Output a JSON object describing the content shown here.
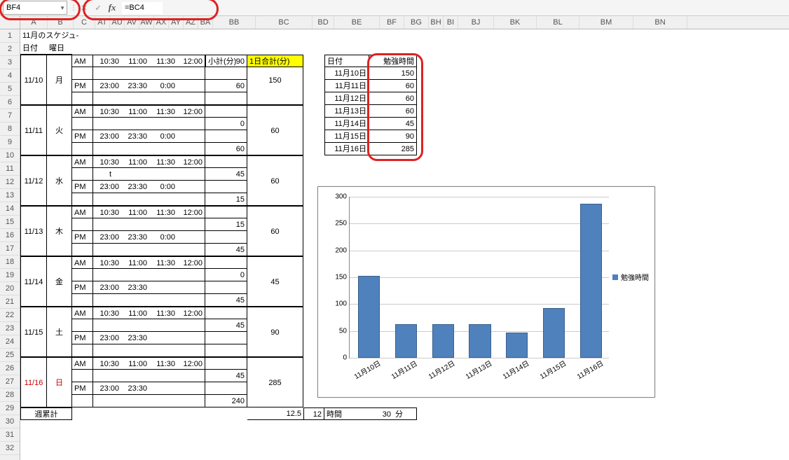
{
  "formula_bar": {
    "cell_ref": "BF4",
    "formula": "=BC4",
    "fx_label": "fx",
    "cancel": "✕",
    "confirm": "✓"
  },
  "columns": [
    "A",
    "B",
    "C",
    "AT",
    "AU",
    "AV",
    "AW",
    "AX",
    "AY",
    "AZ",
    "BA",
    "BB",
    "BC",
    "BD",
    "BE",
    "BF",
    "BG",
    "BH",
    "BI",
    "BJ",
    "BK",
    "BL",
    "BM",
    "BN"
  ],
  "col_widths": {
    "A": 38,
    "B": 36,
    "C": 30,
    "AT": 20,
    "AU": 20,
    "AV": 20,
    "AW": 20,
    "AX": 20,
    "AY": 20,
    "AZ": 20,
    "BA": 20,
    "BB": 60,
    "BC": 80,
    "BD": 30,
    "BE": 64,
    "BF": 34,
    "BG": 34,
    "BH": 20,
    "BI": 20,
    "BJ": 50,
    "BK": 60,
    "BL": 60,
    "BM": 76,
    "BN": 76
  },
  "row_count": 32,
  "title": "11月のスケジュ-",
  "headers": {
    "date": "日付",
    "weekday": "曜日",
    "subtotal": "小計(分)",
    "day_total": "1日合計(分)",
    "study_time": "勉強時間",
    "week_total": "週累計",
    "hours": "時間",
    "minutes": "分",
    "am": "AM",
    "pm": "PM"
  },
  "schedule": [
    {
      "date": "11/10",
      "wd": "月",
      "am": [
        "10:30",
        "11:00",
        "11:30",
        "12:00"
      ],
      "pm": [
        "23:00",
        "23:30",
        "0:00",
        ""
      ],
      "sub": [
        90,
        "",
        60,
        ""
      ],
      "total": 150
    },
    {
      "date": "11/11",
      "wd": "火",
      "am": [
        "10:30",
        "11:00",
        "11:30",
        "12:00"
      ],
      "pm": [
        "23:00",
        "23:30",
        "0:00",
        ""
      ],
      "sub": [
        "",
        0,
        "",
        60
      ],
      "total": 60
    },
    {
      "date": "11/12",
      "wd": "水",
      "am": [
        "10:30",
        "11:00",
        "11:30",
        "12:00"
      ],
      "pm": [
        "23:00",
        "23:30",
        "0:00",
        ""
      ],
      "sub": [
        "",
        45,
        "",
        15
      ],
      "total": 60,
      "extra_t": true
    },
    {
      "date": "11/13",
      "wd": "木",
      "am": [
        "10:30",
        "11:00",
        "11:30",
        "12:00"
      ],
      "pm": [
        "23:00",
        "23:30",
        "0:00",
        ""
      ],
      "sub": [
        "",
        15,
        "",
        45
      ],
      "total": 60
    },
    {
      "date": "11/14",
      "wd": "金",
      "am": [
        "10:30",
        "11:00",
        "11:30",
        "12:00"
      ],
      "pm": [
        "23:00",
        "23:30",
        "",
        ""
      ],
      "sub": [
        "",
        0,
        "",
        45
      ],
      "total": 45
    },
    {
      "date": "11/15",
      "wd": "土",
      "am": [
        "10:30",
        "11:00",
        "11:30",
        "12:00"
      ],
      "pm": [
        "23:00",
        "23:30",
        "",
        ""
      ],
      "sub": [
        "",
        45,
        "",
        ""
      ],
      "total": 90
    },
    {
      "date": "11/16",
      "wd": "日",
      "am": [
        "10:30",
        "11:00",
        "11:30",
        "12:00"
      ],
      "pm": [
        "23:00",
        "23:30",
        "",
        ""
      ],
      "sub": [
        "",
        45,
        "",
        240
      ],
      "total": 285,
      "red": true
    }
  ],
  "summary_table": [
    {
      "date": "11月10日",
      "val": 150
    },
    {
      "date": "11月11日",
      "val": 60
    },
    {
      "date": "11月12日",
      "val": 60
    },
    {
      "date": "11月13日",
      "val": 60
    },
    {
      "date": "11月14日",
      "val": 45
    },
    {
      "date": "11月15日",
      "val": 90
    },
    {
      "date": "11月16日",
      "val": 285
    }
  ],
  "week_total_val": 12.5,
  "week_hours": 12,
  "week_minutes": 30,
  "chart_data": {
    "type": "bar",
    "categories": [
      "11月10日",
      "11月11日",
      "11月12日",
      "11月13日",
      "11月14日",
      "11月15日",
      "11月16日"
    ],
    "values": [
      150,
      60,
      60,
      60,
      45,
      90,
      285
    ],
    "series_name": "勉強時間",
    "ylim": [
      0,
      300
    ],
    "ystep": 50
  }
}
